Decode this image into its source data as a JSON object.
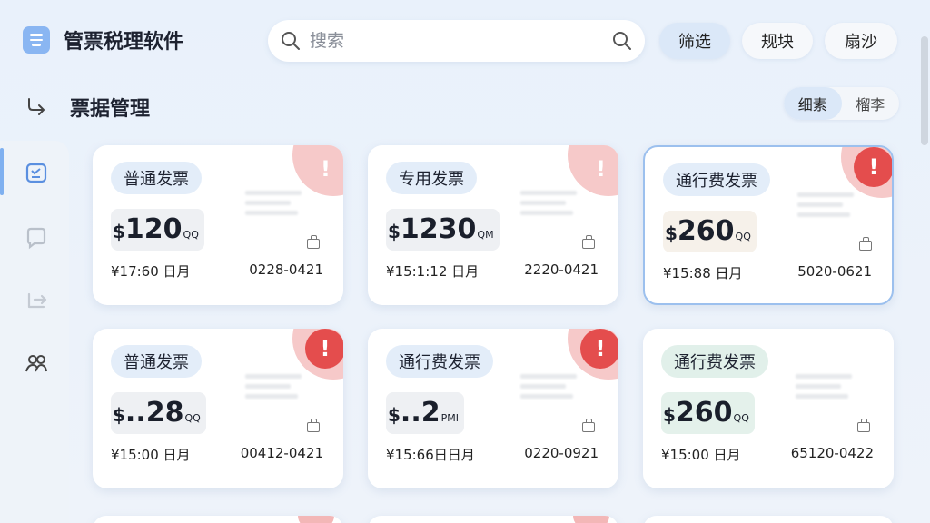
{
  "app": {
    "title": "管票税理软件"
  },
  "search": {
    "placeholder": "搜索"
  },
  "toolbar": {
    "filter_label": "筛选",
    "btn_a_label": "规块",
    "btn_b_label": "扇沙"
  },
  "section": {
    "title": "票据管理"
  },
  "view_toggle": {
    "option_1": "细素",
    "option_2": "榴李"
  },
  "rail": {
    "icons": [
      "calendar-icon",
      "chat-icon",
      "export-icon",
      "people-icon"
    ]
  },
  "cards": [
    {
      "type": "普通发票",
      "currency": "$",
      "amount": "120",
      "suffix": "QQ",
      "date": "¥17:60 日月",
      "code": "0228-0421",
      "alert": "soft",
      "selected": false
    },
    {
      "type": "专用发票",
      "currency": "$",
      "amount": "1230",
      "suffix": "QM",
      "date": "¥15:1:12 日月",
      "code": "2220-0421",
      "alert": "soft",
      "selected": false
    },
    {
      "type": "通行费发票",
      "currency": "$",
      "amount": "260",
      "suffix": "QQ",
      "date": "¥15:88 日月",
      "code": "5020-0621",
      "alert": "badge",
      "selected": true
    },
    {
      "type": "普通发票",
      "currency": "$",
      "amount": "..28",
      "suffix": "QQ",
      "date": "¥15:00 日月",
      "code": "00412-0421",
      "alert": "badge",
      "selected": false
    },
    {
      "type": "通行费发票",
      "currency": "$",
      "amount": "..2",
      "suffix": "PMI",
      "date": "¥15:66日日月",
      "code": "0220-0921",
      "alert": "badge",
      "selected": false
    },
    {
      "type": "通行费发票",
      "currency": "$",
      "amount": "260",
      "suffix": "QQ",
      "date": "¥15:00 日月",
      "code": "65120-0422",
      "alert": "none",
      "selected": false
    }
  ],
  "alert_mark": "!",
  "colors": {
    "accent": "#8ab6f2",
    "alert": "#e44d4d",
    "alert_soft": "#f6c9c9",
    "tag_blue": "#e3edf9",
    "tag_green": "#e1f0ea"
  }
}
